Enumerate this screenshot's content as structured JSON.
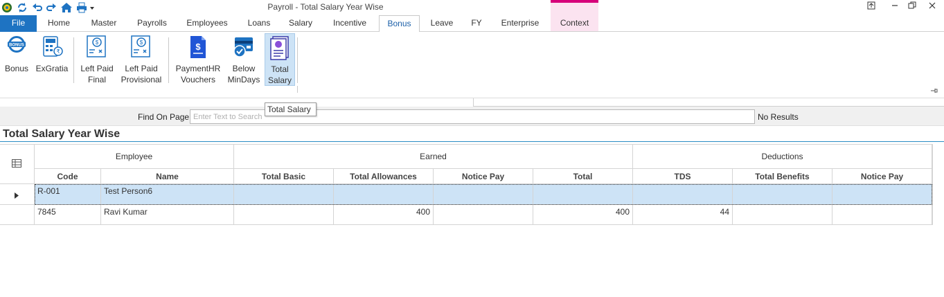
{
  "window": {
    "title": "Payroll - Total Salary Year Wise"
  },
  "qat": {
    "icons": [
      "app-logo-icon",
      "refresh-icon",
      "undo-icon",
      "redo-icon",
      "home-icon",
      "print-icon",
      "dropdown-icon"
    ]
  },
  "tabs": [
    {
      "label": "File"
    },
    {
      "label": "Home"
    },
    {
      "label": "Master"
    },
    {
      "label": "Payrolls"
    },
    {
      "label": "Employees"
    },
    {
      "label": "Loans"
    },
    {
      "label": "Salary"
    },
    {
      "label": "Incentive"
    },
    {
      "label": "Bonus"
    },
    {
      "label": "Leave"
    },
    {
      "label": "FY"
    },
    {
      "label": "Enterprise"
    },
    {
      "label": "Context"
    }
  ],
  "active_tab": "Bonus",
  "ribbon": {
    "buttons": [
      {
        "label": "Bonus",
        "icon": "bonus-badge-icon"
      },
      {
        "label": "ExGratia",
        "icon": "calculator-icon"
      },
      {
        "label": "Left Paid\nFinal",
        "icon": "payslip-icon"
      },
      {
        "label": "Left Paid\nProvisional",
        "icon": "payslip-icon"
      },
      {
        "label": "PaymentHR\nVouchers",
        "icon": "voucher-icon"
      },
      {
        "label": "Below\nMinDays",
        "icon": "card-check-icon"
      },
      {
        "label": "Total\nSalary",
        "icon": "report-icon"
      }
    ],
    "selected": "Total\nSalary"
  },
  "tooltip": {
    "text": "Total Salary"
  },
  "find": {
    "label": "Find On Page",
    "placeholder": "Enter Text to Search",
    "result": "No Results"
  },
  "page": {
    "title": "Total Salary Year Wise"
  },
  "grid": {
    "bands": {
      "employee": "Employee",
      "earned": "Earned",
      "deductions": "Deductions"
    },
    "columns": {
      "code": "Code",
      "name": "Name",
      "total_basic": "Total Basic",
      "total_allowances": "Total Allowances",
      "notice_pay_earned": "Notice Pay",
      "total": "Total",
      "tds": "TDS",
      "total_benefits": "Total Benefits",
      "notice_pay_deduction": "Notice Pay"
    },
    "rows": [
      {
        "code": "R-001",
        "name": "Test Person6",
        "total_basic": "",
        "total_allowances": "",
        "notice_pay_earned": "",
        "total": "",
        "tds": "",
        "total_benefits": "",
        "notice_pay_deduction": ""
      },
      {
        "code": "7845",
        "name": "Ravi Kumar",
        "total_basic": "",
        "total_allowances": "400",
        "notice_pay_earned": "",
        "total": "400",
        "tds": "44",
        "total_benefits": "",
        "notice_pay_deduction": ""
      }
    ]
  },
  "colors": {
    "file_tab": "#1e73c2",
    "context_accent": "#d6007a",
    "selection": "#cde3f6",
    "title_rule": "#2a8cc4"
  }
}
